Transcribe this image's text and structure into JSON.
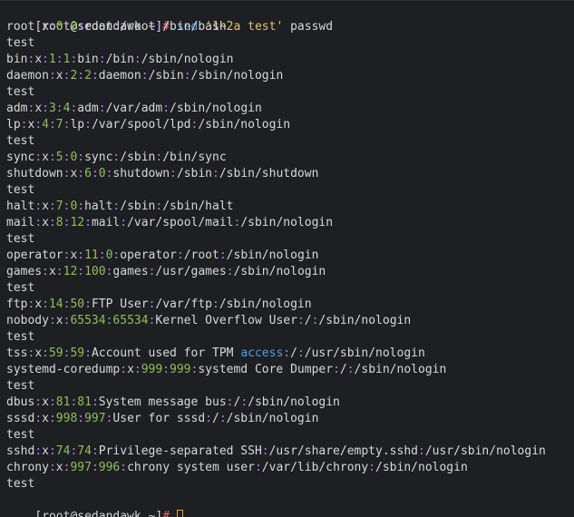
{
  "colors": {
    "text": "#d8d8d8",
    "separator": "#b07ce8",
    "number": "#8fbf5a",
    "keyword": "#4aa0e6",
    "hash": "#e06c75",
    "command": "#4aa0e6",
    "string": "#e5c07b",
    "cursor": "#e6a23c"
  },
  "prompt": {
    "user_host": "[root@sedandawk ~]",
    "symbol": "#"
  },
  "command": {
    "name": "sed",
    "script": "'1~2a test'",
    "argument": "passwd"
  },
  "output": [
    [
      [
        "root",
        "t"
      ],
      [
        ":",
        "s"
      ],
      [
        "x",
        "t"
      ],
      [
        ":",
        "s"
      ],
      [
        "0",
        "n"
      ],
      [
        ":",
        "s"
      ],
      [
        "0",
        "n"
      ],
      [
        ":",
        "s"
      ],
      [
        "root",
        "t"
      ],
      [
        ":",
        "s"
      ],
      [
        "/root",
        "t"
      ],
      [
        ":",
        "s"
      ],
      [
        "/bin/bash",
        "t"
      ]
    ],
    [
      [
        "test",
        "t"
      ]
    ],
    [
      [
        "bin",
        "t"
      ],
      [
        ":",
        "s"
      ],
      [
        "x",
        "t"
      ],
      [
        ":",
        "s"
      ],
      [
        "1",
        "n"
      ],
      [
        ":",
        "s"
      ],
      [
        "1",
        "n"
      ],
      [
        ":",
        "s"
      ],
      [
        "bin",
        "t"
      ],
      [
        ":",
        "s"
      ],
      [
        "/bin",
        "t"
      ],
      [
        ":",
        "s"
      ],
      [
        "/sbin/nologin",
        "t"
      ]
    ],
    [
      [
        "daemon",
        "t"
      ],
      [
        ":",
        "s"
      ],
      [
        "x",
        "t"
      ],
      [
        ":",
        "s"
      ],
      [
        "2",
        "n"
      ],
      [
        ":",
        "s"
      ],
      [
        "2",
        "n"
      ],
      [
        ":",
        "s"
      ],
      [
        "daemon",
        "t"
      ],
      [
        ":",
        "s"
      ],
      [
        "/sbin",
        "t"
      ],
      [
        ":",
        "s"
      ],
      [
        "/sbin/nologin",
        "t"
      ]
    ],
    [
      [
        "test",
        "t"
      ]
    ],
    [
      [
        "adm",
        "t"
      ],
      [
        ":",
        "s"
      ],
      [
        "x",
        "t"
      ],
      [
        ":",
        "s"
      ],
      [
        "3",
        "n"
      ],
      [
        ":",
        "s"
      ],
      [
        "4",
        "n"
      ],
      [
        ":",
        "s"
      ],
      [
        "adm",
        "t"
      ],
      [
        ":",
        "s"
      ],
      [
        "/var/adm",
        "t"
      ],
      [
        ":",
        "s"
      ],
      [
        "/sbin/nologin",
        "t"
      ]
    ],
    [
      [
        "lp",
        "t"
      ],
      [
        ":",
        "s"
      ],
      [
        "x",
        "t"
      ],
      [
        ":",
        "s"
      ],
      [
        "4",
        "n"
      ],
      [
        ":",
        "s"
      ],
      [
        "7",
        "n"
      ],
      [
        ":",
        "s"
      ],
      [
        "lp",
        "t"
      ],
      [
        ":",
        "s"
      ],
      [
        "/var/spool/lpd",
        "t"
      ],
      [
        ":",
        "s"
      ],
      [
        "/sbin/nologin",
        "t"
      ]
    ],
    [
      [
        "test",
        "t"
      ]
    ],
    [
      [
        "sync",
        "t"
      ],
      [
        ":",
        "s"
      ],
      [
        "x",
        "t"
      ],
      [
        ":",
        "s"
      ],
      [
        "5",
        "n"
      ],
      [
        ":",
        "s"
      ],
      [
        "0",
        "n"
      ],
      [
        ":",
        "s"
      ],
      [
        "sync",
        "t"
      ],
      [
        ":",
        "s"
      ],
      [
        "/sbin",
        "t"
      ],
      [
        ":",
        "s"
      ],
      [
        "/bin/sync",
        "t"
      ]
    ],
    [
      [
        "shutdown",
        "t"
      ],
      [
        ":",
        "s"
      ],
      [
        "x",
        "t"
      ],
      [
        ":",
        "s"
      ],
      [
        "6",
        "n"
      ],
      [
        ":",
        "s"
      ],
      [
        "0",
        "n"
      ],
      [
        ":",
        "s"
      ],
      [
        "shutdown",
        "t"
      ],
      [
        ":",
        "s"
      ],
      [
        "/sbin",
        "t"
      ],
      [
        ":",
        "s"
      ],
      [
        "/sbin/shutdown",
        "t"
      ]
    ],
    [
      [
        "test",
        "t"
      ]
    ],
    [
      [
        "halt",
        "t"
      ],
      [
        ":",
        "s"
      ],
      [
        "x",
        "t"
      ],
      [
        ":",
        "s"
      ],
      [
        "7",
        "n"
      ],
      [
        ":",
        "s"
      ],
      [
        "0",
        "n"
      ],
      [
        ":",
        "s"
      ],
      [
        "halt",
        "t"
      ],
      [
        ":",
        "s"
      ],
      [
        "/sbin",
        "t"
      ],
      [
        ":",
        "s"
      ],
      [
        "/sbin/halt",
        "t"
      ]
    ],
    [
      [
        "mail",
        "t"
      ],
      [
        ":",
        "s"
      ],
      [
        "x",
        "t"
      ],
      [
        ":",
        "s"
      ],
      [
        "8",
        "n"
      ],
      [
        ":",
        "s"
      ],
      [
        "12",
        "n"
      ],
      [
        ":",
        "s"
      ],
      [
        "mail",
        "t"
      ],
      [
        ":",
        "s"
      ],
      [
        "/var/spool/mail",
        "t"
      ],
      [
        ":",
        "s"
      ],
      [
        "/sbin/nologin",
        "t"
      ]
    ],
    [
      [
        "test",
        "t"
      ]
    ],
    [
      [
        "operator",
        "t"
      ],
      [
        ":",
        "s"
      ],
      [
        "x",
        "t"
      ],
      [
        ":",
        "s"
      ],
      [
        "11",
        "n"
      ],
      [
        ":",
        "s"
      ],
      [
        "0",
        "n"
      ],
      [
        ":",
        "s"
      ],
      [
        "operator",
        "t"
      ],
      [
        ":",
        "s"
      ],
      [
        "/root",
        "t"
      ],
      [
        ":",
        "s"
      ],
      [
        "/sbin/nologin",
        "t"
      ]
    ],
    [
      [
        "games",
        "t"
      ],
      [
        ":",
        "s"
      ],
      [
        "x",
        "t"
      ],
      [
        ":",
        "s"
      ],
      [
        "12",
        "n"
      ],
      [
        ":",
        "s"
      ],
      [
        "100",
        "n"
      ],
      [
        ":",
        "s"
      ],
      [
        "games",
        "t"
      ],
      [
        ":",
        "s"
      ],
      [
        "/usr/games",
        "t"
      ],
      [
        ":",
        "s"
      ],
      [
        "/sbin/nologin",
        "t"
      ]
    ],
    [
      [
        "test",
        "t"
      ]
    ],
    [
      [
        "ftp",
        "t"
      ],
      [
        ":",
        "s"
      ],
      [
        "x",
        "t"
      ],
      [
        ":",
        "s"
      ],
      [
        "14",
        "n"
      ],
      [
        ":",
        "s"
      ],
      [
        "50",
        "n"
      ],
      [
        ":",
        "s"
      ],
      [
        "FTP User",
        "t"
      ],
      [
        ":",
        "s"
      ],
      [
        "/var/ftp",
        "t"
      ],
      [
        ":",
        "s"
      ],
      [
        "/sbin/nologin",
        "t"
      ]
    ],
    [
      [
        "nobody",
        "t"
      ],
      [
        ":",
        "s"
      ],
      [
        "x",
        "t"
      ],
      [
        ":",
        "s"
      ],
      [
        "65534",
        "n"
      ],
      [
        ":",
        "s"
      ],
      [
        "65534",
        "n"
      ],
      [
        ":",
        "s"
      ],
      [
        "Kernel Overflow User",
        "t"
      ],
      [
        ":",
        "s"
      ],
      [
        "/",
        "t"
      ],
      [
        ":",
        "s"
      ],
      [
        "/sbin/nologin",
        "t"
      ]
    ],
    [
      [
        "test",
        "t"
      ]
    ],
    [
      [
        "tss",
        "t"
      ],
      [
        ":",
        "s"
      ],
      [
        "x",
        "t"
      ],
      [
        ":",
        "s"
      ],
      [
        "59",
        "n"
      ],
      [
        ":",
        "s"
      ],
      [
        "59",
        "n"
      ],
      [
        ":",
        "s"
      ],
      [
        "Account used for TPM ",
        "t"
      ],
      [
        "access",
        "k"
      ],
      [
        ":",
        "s"
      ],
      [
        "/",
        "t"
      ],
      [
        ":",
        "s"
      ],
      [
        "/usr/sbin/nologin",
        "t"
      ]
    ],
    [
      [
        "systemd-coredump",
        "t"
      ],
      [
        ":",
        "s"
      ],
      [
        "x",
        "t"
      ],
      [
        ":",
        "s"
      ],
      [
        "999",
        "n"
      ],
      [
        ":",
        "s"
      ],
      [
        "999",
        "n"
      ],
      [
        ":",
        "s"
      ],
      [
        "systemd Core Dumper",
        "t"
      ],
      [
        ":",
        "s"
      ],
      [
        "/",
        "t"
      ],
      [
        ":",
        "s"
      ],
      [
        "/sbin/nologin",
        "t"
      ]
    ],
    [
      [
        "test",
        "t"
      ]
    ],
    [
      [
        "dbus",
        "t"
      ],
      [
        ":",
        "s"
      ],
      [
        "x",
        "t"
      ],
      [
        ":",
        "s"
      ],
      [
        "81",
        "n"
      ],
      [
        ":",
        "s"
      ],
      [
        "81",
        "n"
      ],
      [
        ":",
        "s"
      ],
      [
        "System message bus",
        "t"
      ],
      [
        ":",
        "s"
      ],
      [
        "/",
        "t"
      ],
      [
        ":",
        "s"
      ],
      [
        "/sbin/nologin",
        "t"
      ]
    ],
    [
      [
        "sssd",
        "t"
      ],
      [
        ":",
        "s"
      ],
      [
        "x",
        "t"
      ],
      [
        ":",
        "s"
      ],
      [
        "998",
        "n"
      ],
      [
        ":",
        "s"
      ],
      [
        "997",
        "n"
      ],
      [
        ":",
        "s"
      ],
      [
        "User for sssd",
        "t"
      ],
      [
        ":",
        "s"
      ],
      [
        "/",
        "t"
      ],
      [
        ":",
        "s"
      ],
      [
        "/sbin/nologin",
        "t"
      ]
    ],
    [
      [
        "test",
        "t"
      ]
    ],
    [
      [
        "sshd",
        "t"
      ],
      [
        ":",
        "s"
      ],
      [
        "x",
        "t"
      ],
      [
        ":",
        "s"
      ],
      [
        "74",
        "n"
      ],
      [
        ":",
        "s"
      ],
      [
        "74",
        "n"
      ],
      [
        ":",
        "s"
      ],
      [
        "Privilege-separated SSH",
        "t"
      ],
      [
        ":",
        "s"
      ],
      [
        "/usr/share/empty.sshd",
        "t"
      ],
      [
        ":",
        "s"
      ],
      [
        "/usr/sbin/nologin",
        "t"
      ]
    ],
    [
      [
        "chrony",
        "t"
      ],
      [
        ":",
        "s"
      ],
      [
        "x",
        "t"
      ],
      [
        ":",
        "s"
      ],
      [
        "997",
        "n"
      ],
      [
        ":",
        "s"
      ],
      [
        "996",
        "n"
      ],
      [
        ":",
        "s"
      ],
      [
        "chrony system user",
        "t"
      ],
      [
        ":",
        "s"
      ],
      [
        "/var/lib/chrony",
        "t"
      ],
      [
        ":",
        "s"
      ],
      [
        "/sbin/nologin",
        "t"
      ]
    ],
    [
      [
        "test",
        "t"
      ]
    ]
  ]
}
